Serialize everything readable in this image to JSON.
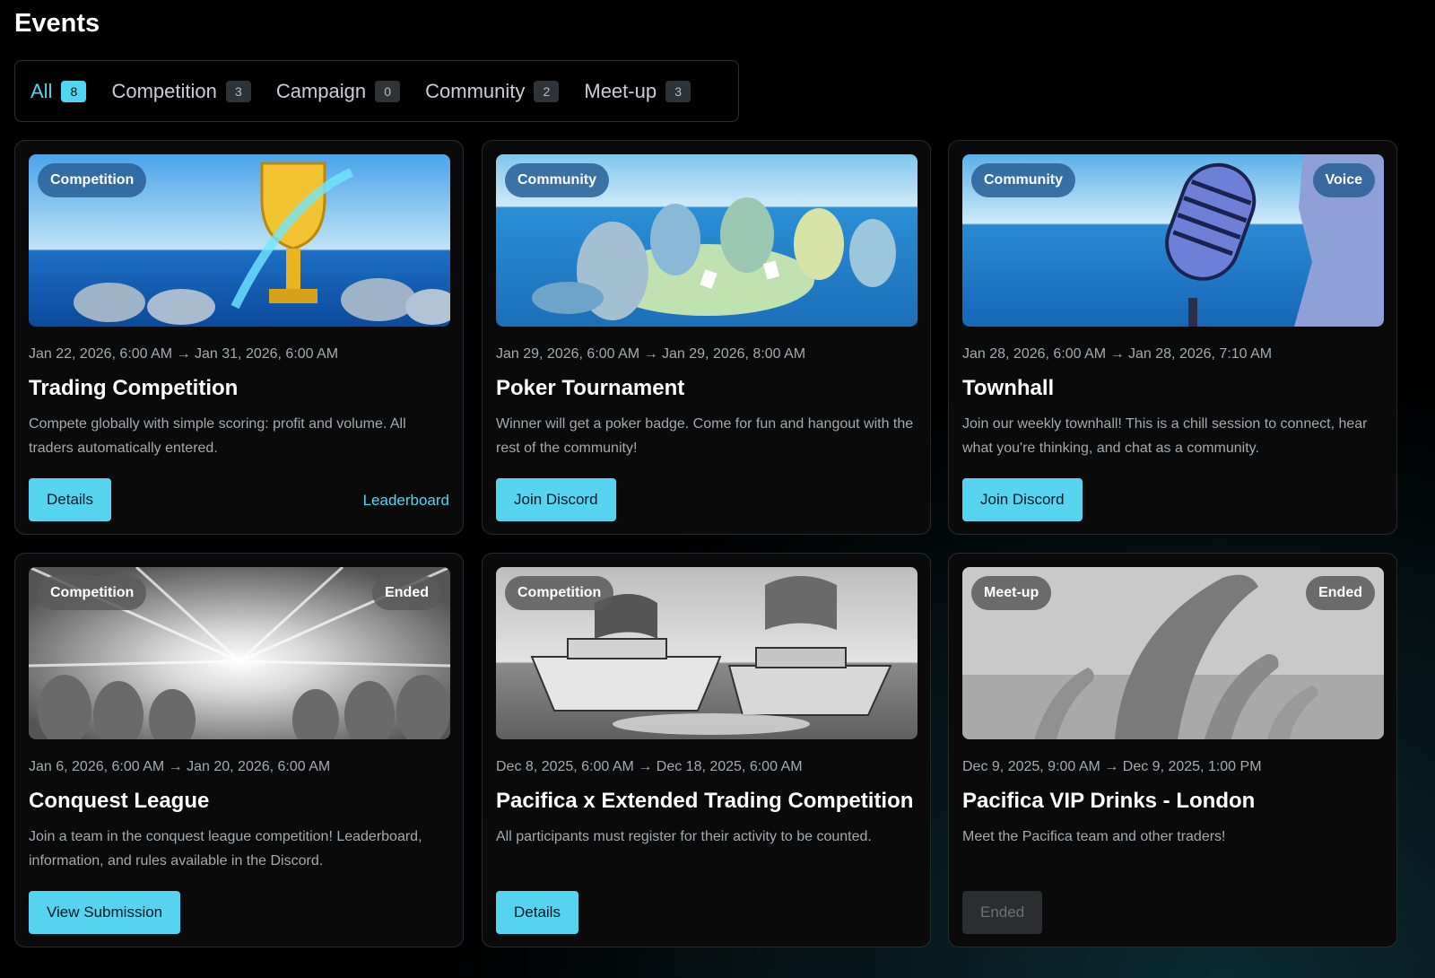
{
  "page_title": "Events",
  "tabs": [
    {
      "label": "All",
      "count": "8"
    },
    {
      "label": "Competition",
      "count": "3"
    },
    {
      "label": "Campaign",
      "count": "0"
    },
    {
      "label": "Community",
      "count": "2"
    },
    {
      "label": "Meet-up",
      "count": "3"
    }
  ],
  "cards": [
    {
      "category": "Competition",
      "date": "Jan 22, 2026, 6:00 AM → Jan 31, 2026, 6:00 AM",
      "title": "Trading Competition",
      "description": "Compete globally with simple scoring: profit and volume. All traders automatically entered.",
      "button": "Details",
      "link": "Leaderboard"
    },
    {
      "category": "Community",
      "date": "Jan 29, 2026, 6:00 AM → Jan 29, 2026, 8:00 AM",
      "title": "Poker Tournament",
      "description": "Winner will get a poker badge. Come for fun and hangout with the rest of the community!",
      "button": "Join Discord"
    },
    {
      "category": "Community",
      "badge": "Voice",
      "date": "Jan 28, 2026, 6:00 AM → Jan 28, 2026, 7:10 AM",
      "title": "Townhall",
      "description": "Join our weekly townhall! This is a chill session to connect, hear what you're thinking, and chat as a community.",
      "button": "Join Discord"
    },
    {
      "category": "Competition",
      "badge": "Ended",
      "date": "Jan 6, 2026, 6:00 AM → Jan 20, 2026, 6:00 AM",
      "title": "Conquest League",
      "description": "Join a team in the conquest league competition! Leaderboard, information, and rules available in the Discord.",
      "button": "View Submission"
    },
    {
      "category": "Competition",
      "date": "Dec 8, 2025, 6:00 AM → Dec 18, 2025, 6:00 AM",
      "title": "Pacifica x Extended Trading Competition",
      "description": "All participants must register for their activity to be counted.",
      "button": "Details"
    },
    {
      "category": "Meet-up",
      "badge": "Ended",
      "date": "Dec 9, 2025, 9:00 AM → Dec 9, 2025, 1:00 PM",
      "title": "Pacifica VIP Drinks - London",
      "description": "Meet the Pacifica team and other traders!",
      "button": "Ended"
    }
  ],
  "colors": {
    "accent": "#4fd6f0",
    "button_bg": "#55d3ef",
    "active_pill": "#285f96",
    "ended_pill": "#5a5a5a"
  }
}
